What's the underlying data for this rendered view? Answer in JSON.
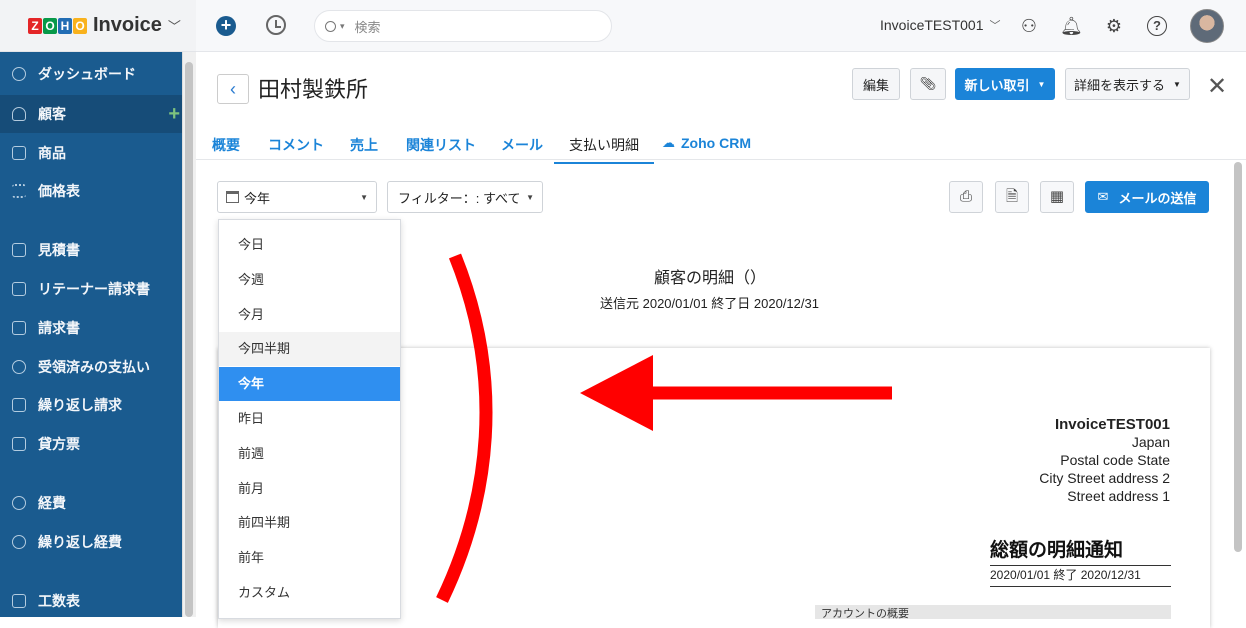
{
  "app": {
    "logo_letters": [
      "Z",
      "O",
      "H",
      "O"
    ],
    "logo_colors": [
      "#e42527",
      "#089949",
      "#226db4",
      "#f9b21d"
    ],
    "name": "Invoice"
  },
  "topbar": {
    "search_placeholder": "検索",
    "org": "InvoiceTEST001"
  },
  "sidebar": {
    "items": [
      {
        "label": "ダッシュボード",
        "icon": "dashboard-icon"
      },
      {
        "label": "顧客",
        "icon": "user-icon",
        "active": true
      },
      {
        "label": "商品",
        "icon": "basket-icon"
      },
      {
        "label": "価格表",
        "icon": "list-icon"
      },
      {
        "label": "見積書",
        "icon": "quote-icon"
      },
      {
        "label": "リテーナー請求書",
        "icon": "retainer-icon"
      },
      {
        "label": "請求書",
        "icon": "invoice-icon"
      },
      {
        "label": "受領済みの支払い",
        "icon": "payment-icon"
      },
      {
        "label": "繰り返し請求",
        "icon": "recurring-icon"
      },
      {
        "label": "貸方票",
        "icon": "credit-note-icon"
      },
      {
        "label": "経費",
        "icon": "expense-icon"
      },
      {
        "label": "繰り返し経費",
        "icon": "recurring-expense-icon"
      },
      {
        "label": "工数表",
        "icon": "timesheet-icon"
      }
    ]
  },
  "header": {
    "customer_name": "田村製鉄所",
    "edit": "編集",
    "new_transaction": "新しい取引",
    "more_details": "詳細を表示する"
  },
  "tabs": [
    "概要",
    "コメント",
    "売上",
    "関連リスト",
    "メール",
    "支払い明細",
    "Zoho CRM"
  ],
  "filters": {
    "period": "今年",
    "filter": "フィルター：: すべて",
    "send_email": "メールの送信"
  },
  "dropdown": {
    "options": [
      "今日",
      "今週",
      "今月",
      "今四半期",
      "今年",
      "昨日",
      "前週",
      "前月",
      "前四半期",
      "前年",
      "カスタム"
    ],
    "selected": "今年",
    "hovered": "今四半期"
  },
  "statement": {
    "title": "顧客の明細（）",
    "range": "送信元 2020/01/01 終了日 2020/12/31",
    "org_name": "InvoiceTEST001",
    "address": [
      "Japan",
      "Postal code State",
      "City  Street address 2",
      "Street address 1"
    ],
    "summary_title": "総額の明細通知",
    "summary_range": "2020/01/01 終了 2020/12/31",
    "account_summary": "アカウントの概要"
  },
  "colors": {
    "sidebar": "#1a5b8f",
    "primary": "#1b84d8",
    "selected": "#2f8ff0",
    "annotation": "#ff0000"
  }
}
